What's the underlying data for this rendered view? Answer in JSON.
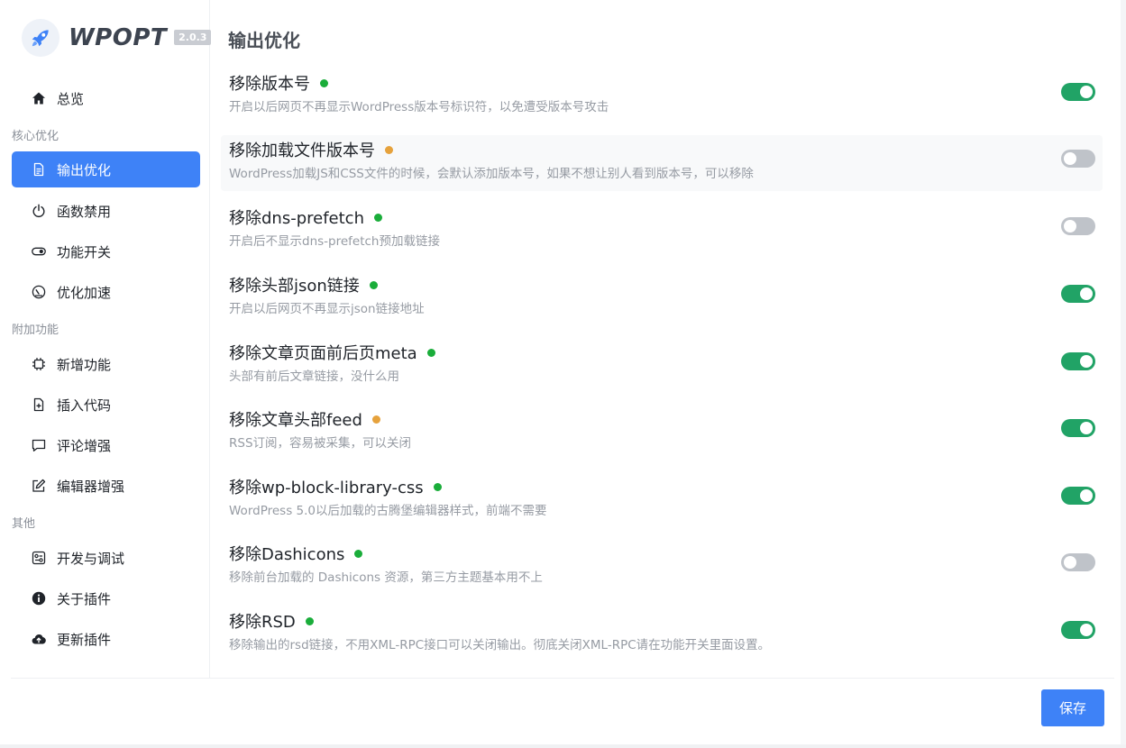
{
  "app": {
    "name": "WPOPT",
    "version": "2.0.3"
  },
  "colors": {
    "accent": "#3e82f7",
    "toggle_on": "#21a366",
    "toggle_off": "#bfc3c9",
    "dot_green": "#1aad3a",
    "dot_orange": "#e6a23c"
  },
  "sidebar": {
    "overview": {
      "label": "总览",
      "icon": "home-icon"
    },
    "sections": [
      {
        "title": "核心优化",
        "items": [
          {
            "label": "输出优化",
            "icon": "document-icon",
            "active": true
          },
          {
            "label": "函数禁用",
            "icon": "power-icon"
          },
          {
            "label": "功能开关",
            "icon": "toggle-icon"
          },
          {
            "label": "优化加速",
            "icon": "speedometer-icon"
          }
        ]
      },
      {
        "title": "附加功能",
        "items": [
          {
            "label": "新增功能",
            "icon": "chip-icon"
          },
          {
            "label": "插入代码",
            "icon": "file-plus-icon"
          },
          {
            "label": "评论增强",
            "icon": "comment-icon"
          },
          {
            "label": "编辑器增强",
            "icon": "edit-icon"
          }
        ]
      },
      {
        "title": "其他",
        "items": [
          {
            "label": "开发与调试",
            "icon": "debug-icon"
          },
          {
            "label": "关于插件",
            "icon": "info-icon"
          },
          {
            "label": "更新插件",
            "icon": "cloud-upload-icon"
          }
        ]
      }
    ]
  },
  "main": {
    "title": "输出优化",
    "settings": [
      {
        "name": "移除版本号",
        "status": "green",
        "desc": "开启以后网页不再显示WordPress版本号标识符，以免遭受版本号攻击",
        "enabled": true
      },
      {
        "name": "移除加载文件版本号",
        "status": "orange",
        "desc": "WordPress加载JS和CSS文件的时候，会默认添加版本号，如果不想让别人看到版本号，可以移除",
        "enabled": false
      },
      {
        "name": "移除dns-prefetch",
        "status": "green",
        "desc": "开启后不显示dns-prefetch预加载链接",
        "enabled": false
      },
      {
        "name": "移除头部json链接",
        "status": "green",
        "desc": "开启以后网页不再显示json链接地址",
        "enabled": true
      },
      {
        "name": "移除文章页面前后页meta",
        "status": "green",
        "desc": "头部有前后文章链接，没什么用",
        "enabled": true
      },
      {
        "name": "移除文章头部feed",
        "status": "orange",
        "desc": "RSS订阅，容易被采集，可以关闭",
        "enabled": true
      },
      {
        "name": "移除wp-block-library-css",
        "status": "green",
        "desc": "WordPress 5.0以后加载的古腾堡编辑器样式，前端不需要",
        "enabled": true
      },
      {
        "name": "移除Dashicons",
        "status": "green",
        "desc": "移除前台加载的 Dashicons 资源，第三方主题基本用不上",
        "enabled": false
      },
      {
        "name": "移除RSD",
        "status": "green",
        "desc": "移除输出的rsd链接，不用XML-RPC接口可以关闭输出。彻底关闭XML-RPC请在功能开关里面设置。",
        "enabled": true
      }
    ]
  },
  "footer": {
    "save_label": "保存"
  }
}
